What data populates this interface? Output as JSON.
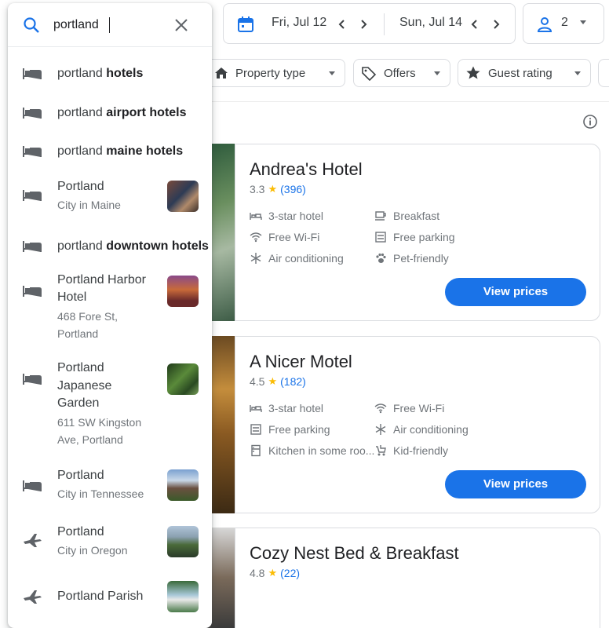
{
  "search": {
    "value": "portland",
    "placeholder": ""
  },
  "suggestions": [
    {
      "icon": "hotel-icon",
      "prefix": "portland",
      "bold": "hotels"
    },
    {
      "icon": "hotel-icon",
      "prefix": "portland",
      "bold": "airport hotels"
    },
    {
      "icon": "hotel-icon",
      "prefix": "portland",
      "bold": "maine hotels"
    },
    {
      "icon": "hotel-icon",
      "title": "Portland",
      "subtitle": "City in Maine"
    },
    {
      "icon": "hotel-icon",
      "prefix": "portland",
      "bold": "downtown hotels"
    },
    {
      "icon": "hotel-icon",
      "title_lines": [
        "Portland Harbor",
        "Hotel"
      ],
      "subtitle_lines": [
        "468 Fore St,",
        "Portland"
      ]
    },
    {
      "icon": "hotel-icon",
      "title_lines": [
        "Portland",
        "Japanese",
        "Garden"
      ],
      "subtitle_lines": [
        "611 SW Kingston",
        "Ave, Portland"
      ]
    },
    {
      "icon": "hotel-icon",
      "title": "Portland",
      "subtitle": "City in Tennessee"
    },
    {
      "icon": "plane-icon",
      "title": "Portland",
      "subtitle": "City in Oregon"
    },
    {
      "icon": "plane-icon",
      "title": "Portland Parish"
    }
  ],
  "dates": {
    "checkin": "Fri, Jul 12",
    "checkout": "Sun, Jul 14"
  },
  "guests": "2",
  "filters": [
    "Property type",
    "Offers",
    "Guest rating"
  ],
  "hotels": [
    {
      "name": "Andrea's Hotel",
      "rating": "3.3",
      "reviews": "(396)",
      "amenities": [
        {
          "label": "3-star hotel",
          "icon": "hotel-class-icon"
        },
        {
          "label": "Breakfast",
          "icon": "breakfast-icon"
        },
        {
          "label": "Free Wi-Fi",
          "icon": "wifi-icon"
        },
        {
          "label": "Free parking",
          "icon": "parking-icon"
        },
        {
          "label": "Air conditioning",
          "icon": "snowflake-icon"
        },
        {
          "label": "Pet-friendly",
          "icon": "paw-icon"
        }
      ],
      "button": "View prices"
    },
    {
      "name": "A Nicer Motel",
      "rating": "4.5",
      "reviews": "(182)",
      "amenities": [
        {
          "label": "3-star hotel",
          "icon": "hotel-class-icon"
        },
        {
          "label": "Free Wi-Fi",
          "icon": "wifi-icon"
        },
        {
          "label": "Free parking",
          "icon": "parking-icon"
        },
        {
          "label": "Air conditioning",
          "icon": "snowflake-icon"
        },
        {
          "label": "Kitchen in some roo...",
          "icon": "kitchen-icon"
        },
        {
          "label": "Kid-friendly",
          "icon": "stroller-icon"
        }
      ],
      "button": "View prices"
    },
    {
      "name": "Cozy Nest Bed & Breakfast",
      "rating": "4.8",
      "reviews": "(22)"
    }
  ],
  "colors": {
    "accent": "#1a73e8",
    "star": "#fbbc04",
    "text_secondary": "#70757a",
    "border": "#dadce0"
  }
}
